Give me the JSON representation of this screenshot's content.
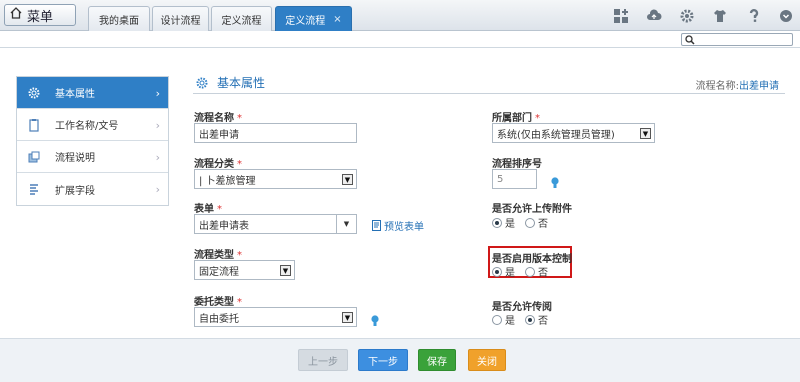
{
  "topbar": {
    "menu_label": "菜单",
    "tabs": [
      {
        "label": "我的桌面"
      },
      {
        "label": "设计流程"
      },
      {
        "label": "定义流程"
      },
      {
        "label": "定义流程",
        "close": "×"
      }
    ]
  },
  "sidebar": {
    "items": [
      {
        "label": "基本属性",
        "icon": "gear-icon"
      },
      {
        "label": "工作名称/文号",
        "icon": "clipboard-icon"
      },
      {
        "label": "流程说明",
        "icon": "document-icon"
      },
      {
        "label": "扩展字段",
        "icon": "list-icon"
      }
    ]
  },
  "panel": {
    "title": "基本属性",
    "flow_name_caption": "流程名称:",
    "flow_name_value": "出差申请"
  },
  "form": {
    "flow_name": {
      "label": "流程名称",
      "value": "出差申请"
    },
    "flow_category": {
      "label": "流程分类",
      "value": "|   卜差旅管理"
    },
    "form_field": {
      "label": "表单",
      "value": "出差申请表",
      "preview": "预览表单"
    },
    "flow_type": {
      "label": "流程类型",
      "value": "固定流程"
    },
    "delegate_type": {
      "label": "委托类型",
      "value": "自由委托"
    },
    "department": {
      "label": "所属部门",
      "value": "系统(仅由系统管理员管理)"
    },
    "sort_no": {
      "label": "流程排序号",
      "value": "5"
    },
    "allow_attach": {
      "label": "是否允许上传附件",
      "yes": "是",
      "no": "否",
      "selected": "yes"
    },
    "version_ctrl": {
      "label": "是否启用版本控制",
      "yes": "是",
      "no": "否",
      "selected": "yes"
    },
    "allow_read": {
      "label": "是否允许传阅",
      "yes": "是",
      "no": "否",
      "selected": "no"
    },
    "required_mark": "*"
  },
  "footer": {
    "prev": "上一步",
    "next": "下一步",
    "save": "保存",
    "close": "关闭"
  },
  "colors": {
    "accent": "#2f7fc6",
    "next": "#3d8fe0",
    "save": "#3aa23a",
    "close": "#f0a12b",
    "prev_disabled": "#d5dbe1",
    "highlight": "#d01818"
  }
}
